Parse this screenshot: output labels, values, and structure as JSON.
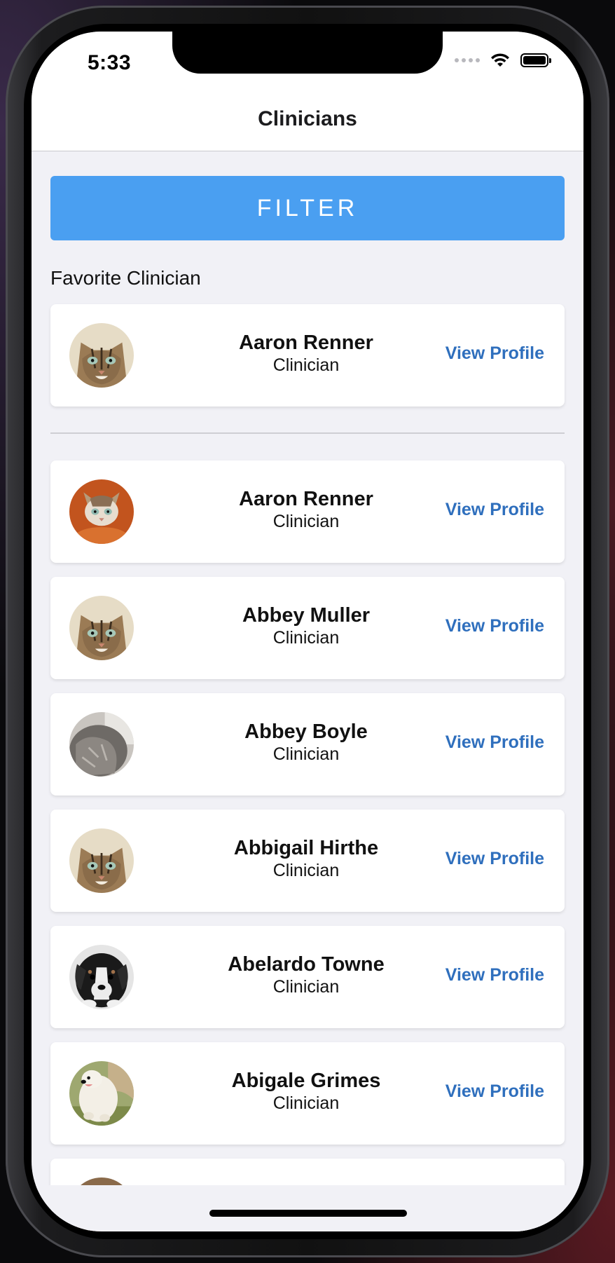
{
  "status_bar": {
    "time": "5:33"
  },
  "nav": {
    "title": "Clinicians"
  },
  "filter_button": {
    "label": "FILTER"
  },
  "favorite_section": {
    "label": "Favorite Clinician"
  },
  "favorite": {
    "name": "Aaron Renner",
    "role": "Clinician",
    "link": "View Profile",
    "avatar": "tabby-cat"
  },
  "clinicians": [
    {
      "name": "Aaron Renner",
      "role": "Clinician",
      "link": "View Profile",
      "avatar": "cat-orange"
    },
    {
      "name": "Abbey Muller",
      "role": "Clinician",
      "link": "View Profile",
      "avatar": "tabby-cat"
    },
    {
      "name": "Abbey Boyle",
      "role": "Clinician",
      "link": "View Profile",
      "avatar": "grey-cat"
    },
    {
      "name": "Abbigail Hirthe",
      "role": "Clinician",
      "link": "View Profile",
      "avatar": "tabby-cat"
    },
    {
      "name": "Abelardo Towne",
      "role": "Clinician",
      "link": "View Profile",
      "avatar": "puppy"
    },
    {
      "name": "Abigale Grimes",
      "role": "Clinician",
      "link": "View Profile",
      "avatar": "white-dog"
    }
  ],
  "colors": {
    "accent": "#4a9ff1",
    "link": "#2f6fbd",
    "background": "#f1f1f6"
  }
}
